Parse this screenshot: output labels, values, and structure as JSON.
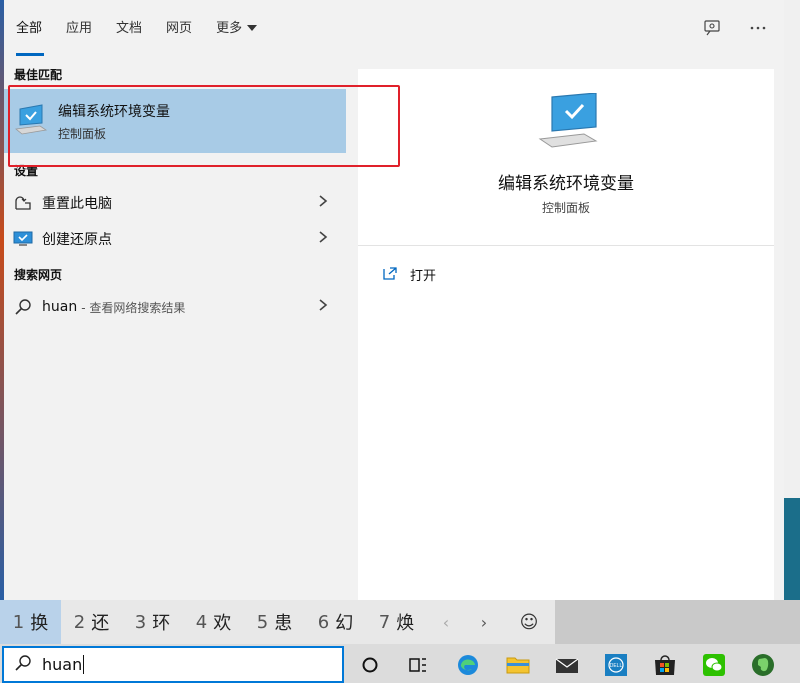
{
  "tabs": {
    "all": "全部",
    "apps": "应用",
    "documents": "文档",
    "web": "网页",
    "more": "更多"
  },
  "best_match": {
    "header": "最佳匹配",
    "title": "编辑系统环境变量",
    "subtitle": "控制面板"
  },
  "settings": {
    "header": "设置",
    "items": [
      {
        "label": "重置此电脑"
      },
      {
        "label": "创建还原点"
      }
    ]
  },
  "web_search": {
    "header": "搜索网页",
    "query": "huan",
    "hint": "- 查看网络搜索结果"
  },
  "detail": {
    "title": "编辑系统环境变量",
    "subtitle": "控制面板",
    "open_label": "打开"
  },
  "ime": {
    "candidates": [
      {
        "num": "1",
        "char": "换"
      },
      {
        "num": "2",
        "char": "还"
      },
      {
        "num": "3",
        "char": "环"
      },
      {
        "num": "4",
        "char": "欢"
      },
      {
        "num": "5",
        "char": "患"
      },
      {
        "num": "6",
        "char": "幻"
      },
      {
        "num": "7",
        "char": "焕"
      }
    ],
    "prev": "‹",
    "next": "›",
    "emoji": "☺"
  },
  "taskbar": {
    "search_value": "huan"
  },
  "colors": {
    "accent": "#0067c0",
    "highlight": "#a8cbe6",
    "annotation_box": "#e0202a"
  }
}
